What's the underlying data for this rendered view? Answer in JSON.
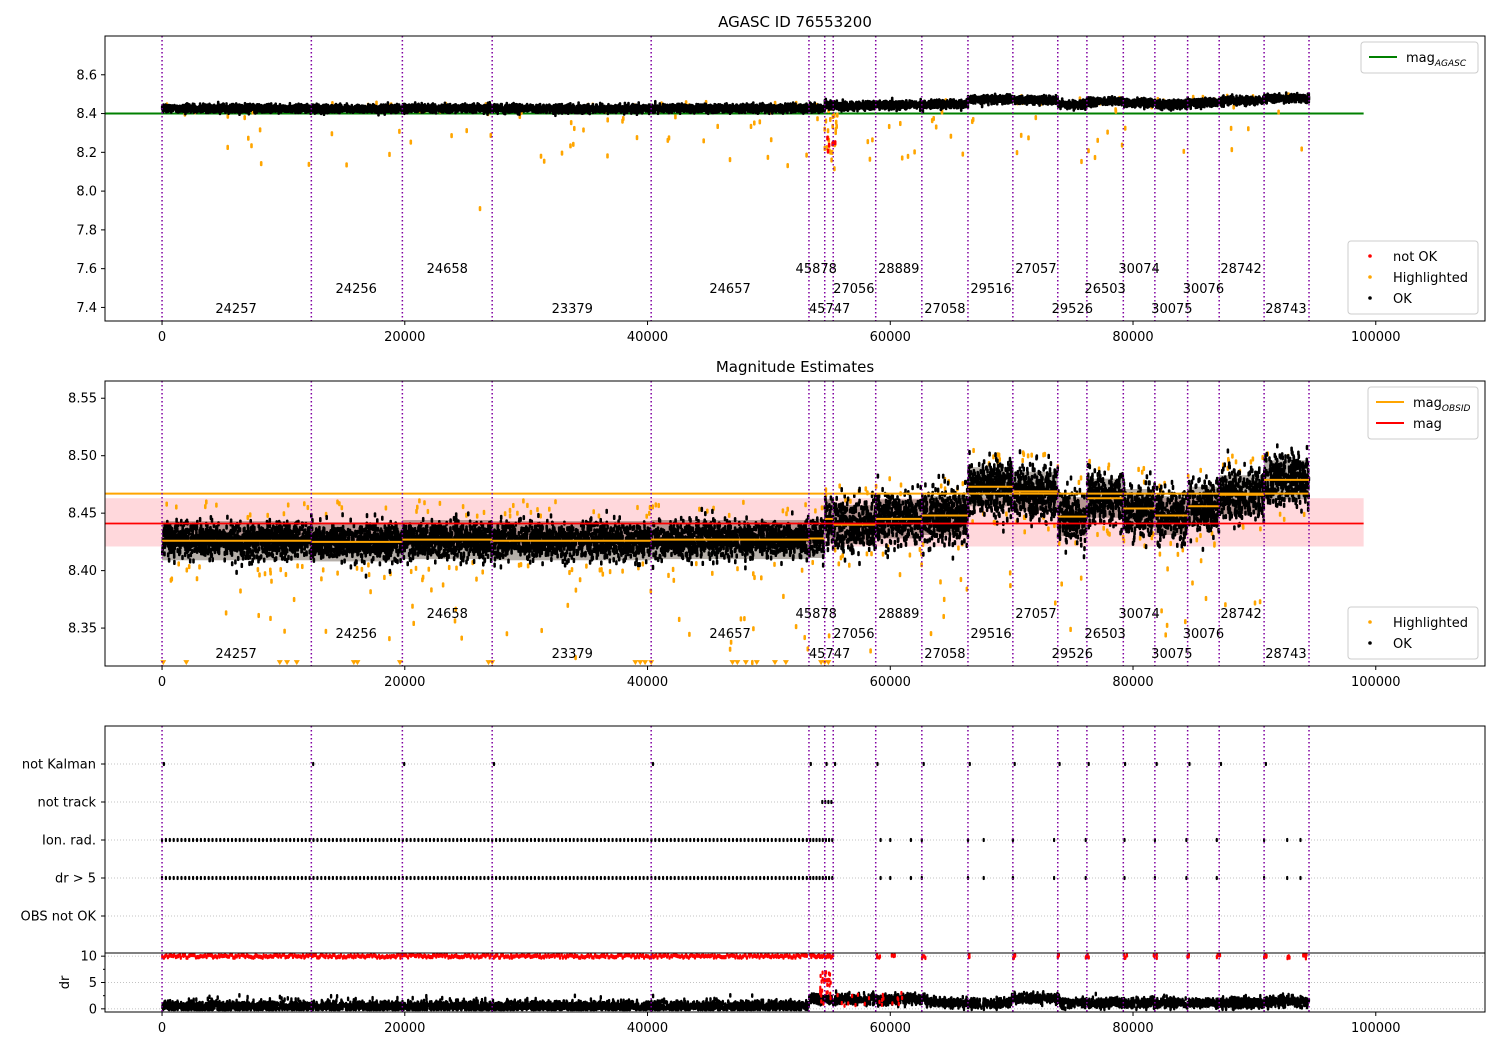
{
  "chart_data": [
    {
      "type": "scatter",
      "title": "AGASC ID 76553200",
      "xlim": [
        -4700,
        109000
      ],
      "ylim": [
        7.33,
        8.8
      ],
      "xticks": [
        0,
        20000,
        40000,
        60000,
        80000,
        100000
      ],
      "xtick_labels": [
        "0",
        "20000",
        "40000",
        "60000",
        "80000",
        "100000"
      ],
      "yticks": [
        7.4,
        7.6,
        7.8,
        8.0,
        8.2,
        8.4,
        8.6
      ],
      "ytick_labels": [
        "7.4",
        "7.6",
        "7.8",
        "8.0",
        "8.2",
        "8.4",
        "8.6"
      ],
      "hlines": [
        {
          "name": "mag_AGASC",
          "y": 8.4,
          "color": "#008000",
          "x_range": [
            -4700,
            99000
          ]
        }
      ],
      "scatter_series": [
        {
          "name": "not OK",
          "color": "#ff0000"
        },
        {
          "name": "Highlighted",
          "color": "#ffa500"
        },
        {
          "name": "OK",
          "color": "#000000"
        }
      ],
      "legend_upper": {
        "position": "upper right",
        "entries": [
          {
            "label": "mag",
            "sub": "AGASC",
            "color": "#008000",
            "kind": "line"
          }
        ]
      },
      "legend_lower": {
        "position": "lower right",
        "entries": [
          {
            "label": "not OK",
            "color": "#ff0000",
            "kind": "dot"
          },
          {
            "label": "Highlighted",
            "color": "#ffa500",
            "kind": "dot"
          },
          {
            "label": "OK",
            "color": "#000000",
            "kind": "dot"
          }
        ]
      }
    },
    {
      "type": "scatter",
      "title": "Magnitude Estimates",
      "xlim": [
        -4700,
        109000
      ],
      "ylim": [
        8.317,
        8.565
      ],
      "xticks": [
        0,
        20000,
        40000,
        60000,
        80000,
        100000
      ],
      "xtick_labels": [
        "0",
        "20000",
        "40000",
        "60000",
        "80000",
        "100000"
      ],
      "yticks": [
        8.35,
        8.4,
        8.45,
        8.5,
        8.55
      ],
      "ytick_labels": [
        "8.35",
        "8.40",
        "8.45",
        "8.50",
        "8.55"
      ],
      "hlines": [
        {
          "name": "mag",
          "y": 8.441,
          "color": "#ff0000",
          "band": [
            8.421,
            8.463
          ],
          "x_range": [
            -4700,
            99000
          ]
        }
      ],
      "mag_obsid_levels": [
        8.426,
        8.425,
        8.427,
        8.426,
        8.427,
        8.428,
        8.445,
        8.44,
        8.445,
        8.448,
        8.473,
        8.469,
        8.447,
        8.463,
        8.454,
        8.448,
        8.456,
        8.466,
        8.479,
        8.467
      ],
      "legend_upper": {
        "position": "upper right",
        "entries": [
          {
            "label": "mag",
            "sub": "OBSID",
            "color": "#ffa500",
            "kind": "line"
          },
          {
            "label": "mag",
            "sub": "",
            "color": "#ff0000",
            "kind": "line"
          }
        ]
      },
      "legend_lower": {
        "position": "lower right",
        "entries": [
          {
            "label": "Highlighted",
            "color": "#ffa500",
            "kind": "dot"
          },
          {
            "label": "OK",
            "color": "#000000",
            "kind": "dot"
          }
        ]
      }
    },
    {
      "type": "scatter",
      "title": "",
      "xlim": [
        -4700,
        109000
      ],
      "flag_labels": [
        "not Kalman",
        "not track",
        "Ion. rad.",
        "dr > 5",
        "OBS not OK"
      ],
      "dr_yticks": [
        0,
        5,
        10
      ],
      "dr_ytick_labels": [
        "0",
        "5",
        "10"
      ],
      "dr_ylabel": "dr",
      "dr_ylim": [
        -0.6,
        10.6
      ],
      "xticks": [
        0,
        20000,
        40000,
        60000,
        80000,
        100000
      ],
      "xtick_labels": [
        "0",
        "20000",
        "40000",
        "60000",
        "80000",
        "100000"
      ]
    }
  ],
  "observations": {
    "boundaries": [
      0,
      12300,
      19800,
      27200,
      40300,
      53300,
      54600,
      55300,
      58800,
      62600,
      66400,
      70100,
      73800,
      76200,
      79200,
      81800,
      84500,
      87100,
      90800,
      94500
    ],
    "labels": [
      {
        "id": "24257",
        "x": 6100,
        "row": 2
      },
      {
        "id": "24256",
        "x": 16000,
        "row": 1
      },
      {
        "id": "24658",
        "x": 23500,
        "row": 0
      },
      {
        "id": "23379",
        "x": 33800,
        "row": 2
      },
      {
        "id": "24657",
        "x": 46800,
        "row": 1
      },
      {
        "id": "45878",
        "x": 53900,
        "row": 0
      },
      {
        "id": "45747",
        "x": 55000,
        "row": 2
      },
      {
        "id": "27056",
        "x": 57000,
        "row": 1
      },
      {
        "id": "28889",
        "x": 60700,
        "row": 0
      },
      {
        "id": "27058",
        "x": 64500,
        "row": 2
      },
      {
        "id": "29516",
        "x": 68300,
        "row": 1
      },
      {
        "id": "27057",
        "x": 72000,
        "row": 0
      },
      {
        "id": "29526",
        "x": 75000,
        "row": 2
      },
      {
        "id": "26503",
        "x": 77700,
        "row": 1
      },
      {
        "id": "30074",
        "x": 80500,
        "row": 0
      },
      {
        "id": "30075",
        "x": 83200,
        "row": 2
      },
      {
        "id": "30076",
        "x": 85800,
        "row": 1
      },
      {
        "id": "28742",
        "x": 88900,
        "row": 0
      },
      {
        "id": "28743",
        "x": 92600,
        "row": 2
      }
    ]
  },
  "colors": {
    "ok": "#000000",
    "highlighted": "#ffa500",
    "not_ok": "#ff0000",
    "obs_boundary": "#8000a0",
    "agasc_line": "#008000",
    "mag_line": "#ff0000",
    "mag_band": "#ffd8dc"
  }
}
